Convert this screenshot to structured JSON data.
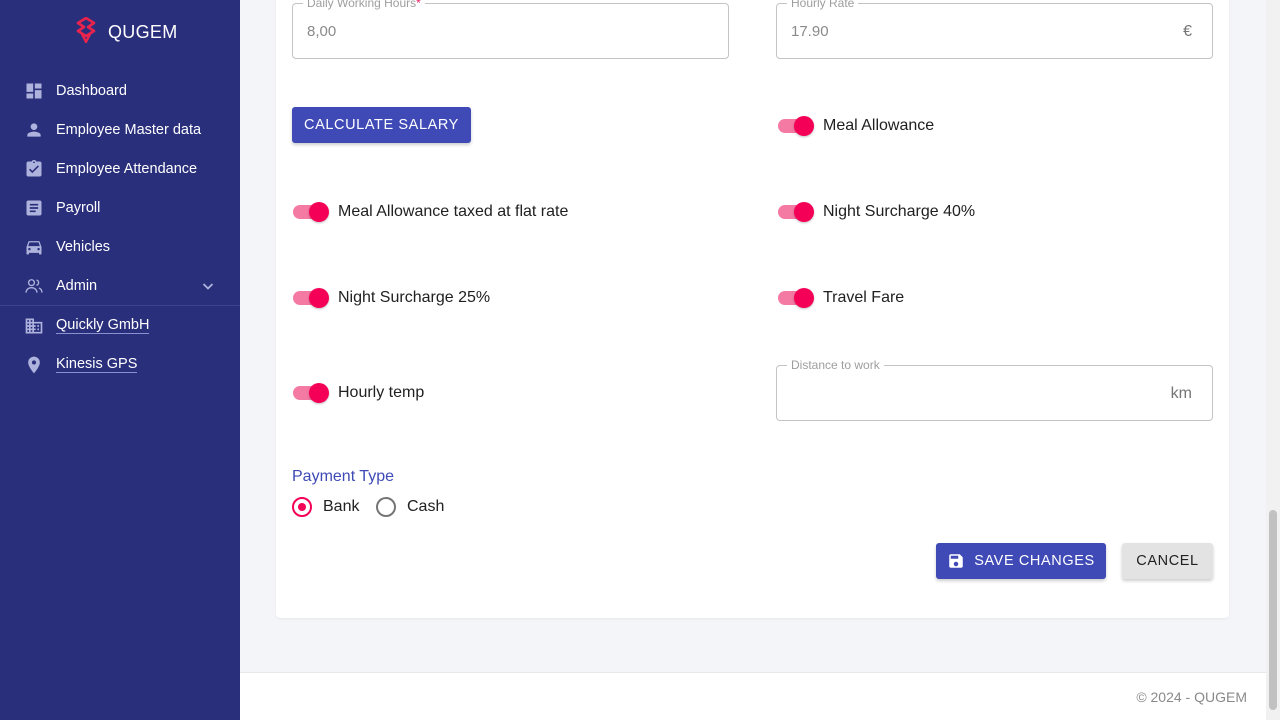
{
  "brand": {
    "name": "QUGEM"
  },
  "sidebar": {
    "items": [
      {
        "label": "Dashboard"
      },
      {
        "label": "Employee Master data"
      },
      {
        "label": "Employee Attendance"
      },
      {
        "label": "Payroll"
      },
      {
        "label": "Vehicles"
      },
      {
        "label": "Admin"
      },
      {
        "label": "Quickly GmbH"
      },
      {
        "label": "Kinesis GPS"
      }
    ]
  },
  "form": {
    "daily_hours": {
      "label": "Daily Working Hours",
      "required_mark": "*",
      "value": "8,00"
    },
    "hourly_rate": {
      "label": "Hourly Rate",
      "value": "17.90",
      "unit": "€"
    },
    "calculate_label": "CALCULATE SALARY",
    "toggles": [
      {
        "label": "Meal Allowance",
        "on": true
      },
      {
        "label": "Meal Allowance taxed at flat rate",
        "on": true
      },
      {
        "label": "Night Surcharge 40%",
        "on": true
      },
      {
        "label": "Night Surcharge 25%",
        "on": true
      },
      {
        "label": "Travel Fare",
        "on": true
      },
      {
        "label": "Hourly temp",
        "on": true
      }
    ],
    "distance": {
      "label": "Distance to work",
      "value": "",
      "unit": "km"
    },
    "payment": {
      "title": "Payment Type",
      "options": [
        {
          "label": "Bank",
          "selected": true
        },
        {
          "label": "Cash",
          "selected": false
        }
      ]
    },
    "save_label": "SAVE CHANGES",
    "cancel_label": "CANCEL"
  },
  "footer": {
    "text": "© 2024 - QUGEM"
  },
  "colors": {
    "sidebar": "#2a2f7c",
    "primary": "#3f4ab6",
    "accent": "#f50057"
  }
}
